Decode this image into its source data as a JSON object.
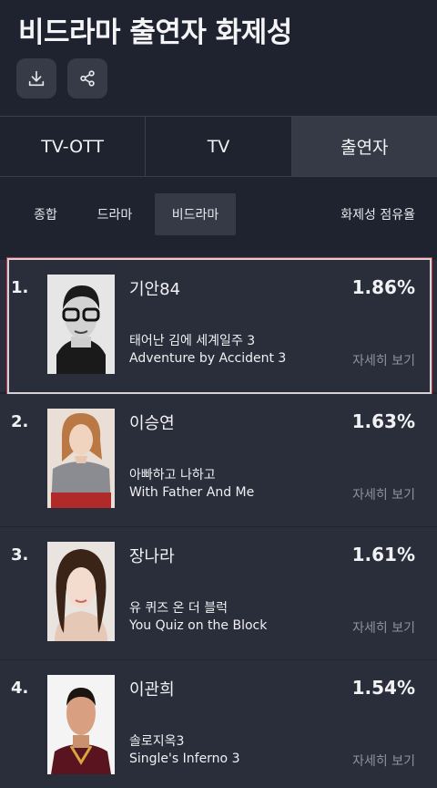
{
  "page_title": "비드라마 출연자 화제성",
  "toolbar": {
    "download_icon": "download-icon",
    "share_icon": "share-icon"
  },
  "tabs": [
    {
      "label": "TV-OTT",
      "active": false
    },
    {
      "label": "TV",
      "active": false
    },
    {
      "label": "출연자",
      "active": true
    }
  ],
  "subtabs": [
    {
      "label": "종합",
      "active": false
    },
    {
      "label": "드라마",
      "active": false
    },
    {
      "label": "비드라마",
      "active": true
    }
  ],
  "share_label": "화제성 점유율",
  "entries": [
    {
      "rank": "1.",
      "name": "기안84",
      "percent": "1.86%",
      "show_ko": "태어난 김에 세계일주 3",
      "show_en": "Adventure by Accident 3",
      "detail": "자세히 보기",
      "highlighted": true
    },
    {
      "rank": "2.",
      "name": "이승연",
      "percent": "1.63%",
      "show_ko": "아빠하고 나하고",
      "show_en": "With Father And Me",
      "detail": "자세히 보기"
    },
    {
      "rank": "3.",
      "name": "장나라",
      "percent": "1.61%",
      "show_ko": "유 퀴즈 온 더 블럭",
      "show_en": "You Quiz on the Block",
      "detail": "자세히 보기"
    },
    {
      "rank": "4.",
      "name": "이관희",
      "percent": "1.54%",
      "show_ko": "솔로지옥3",
      "show_en": "Single's Inferno 3",
      "detail": "자세히 보기"
    }
  ],
  "colors": {
    "background": "#1f2330",
    "card": "#2a2e3b",
    "active_tab": "#363a47",
    "muted_text": "#8e919c"
  }
}
